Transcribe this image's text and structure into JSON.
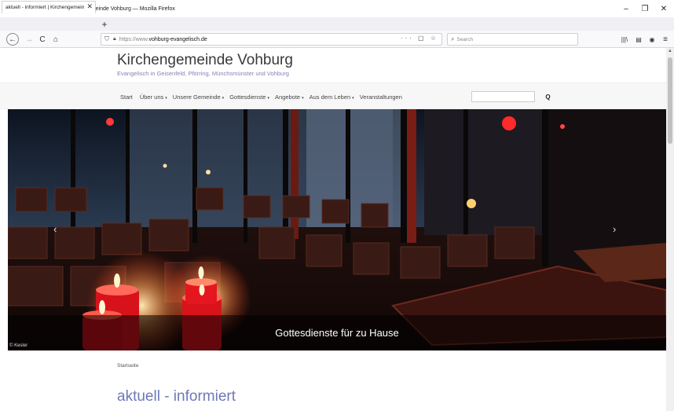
{
  "window": {
    "title": "aktuell - informiert | Kirchengemeinde Vohburg — Mozilla Firefox",
    "minimize": "–",
    "maximize": "❐",
    "close": "✕"
  },
  "tab": {
    "label": "aktuell - informiert | Kirchengemein",
    "close": "✕",
    "new": "+"
  },
  "toolbar": {
    "back": "←",
    "forward": "→",
    "reload": "C",
    "home": "⌂",
    "url_protocol": "https://www.",
    "url_domain": "vohburg-evangelisch.de",
    "url_actions": "··· ▢ ☆",
    "search_placeholder": "Search",
    "library": "|||\\",
    "sidebar": "▤",
    "account": "◉",
    "menu": "≡"
  },
  "site": {
    "title": "Kirchengemeinde Vohburg",
    "subtitle": "Evangelisch in Geisenfeld, Pförring, Münchsmünster und Vohburg"
  },
  "nav": {
    "items": [
      {
        "label": "Start",
        "caret": ""
      },
      {
        "label": "Über uns",
        "caret": "▾"
      },
      {
        "label": "Unsere Gemeinde",
        "caret": "▾"
      },
      {
        "label": "Gottesdienste",
        "caret": "▾"
      },
      {
        "label": "Angebote",
        "caret": "▾"
      },
      {
        "label": "Aus dem Leben",
        "caret": "▾"
      },
      {
        "label": "Veranstaltungen",
        "caret": ""
      }
    ],
    "search_icon": "Q"
  },
  "hero": {
    "caption": "Gottesdienste für zu Hause",
    "credit": "© Kesler",
    "prev": "‹",
    "next": "›"
  },
  "breadcrumb": "Startseite",
  "page_heading": "aktuell - informiert",
  "colors": {
    "accent": "#6e79b6",
    "subtitle": "#8a7fb8"
  }
}
